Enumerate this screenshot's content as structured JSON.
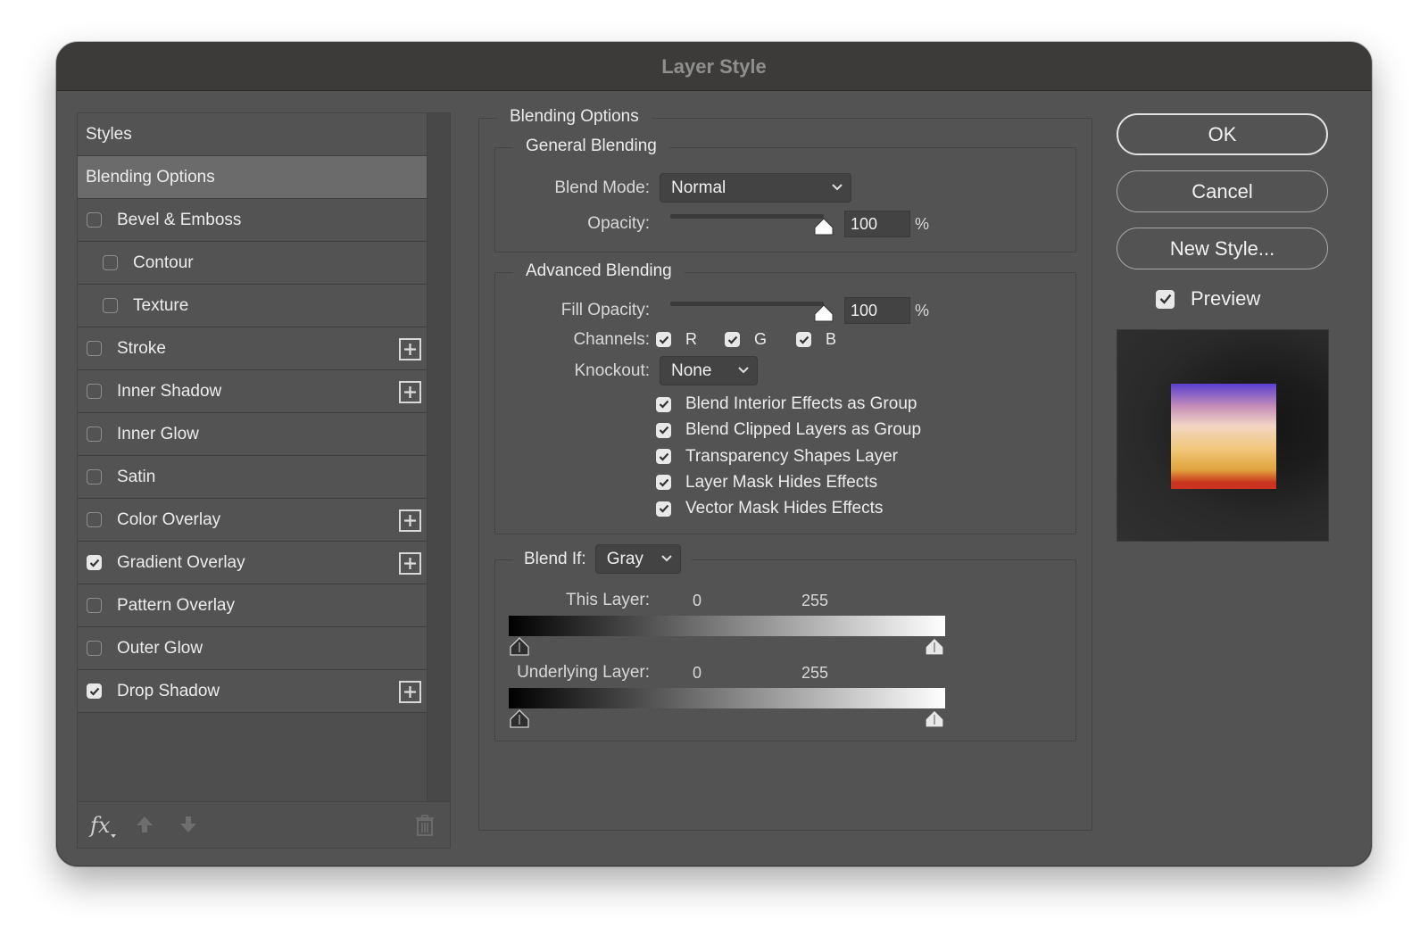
{
  "window": {
    "title": "Layer Style"
  },
  "styles": {
    "header": "Styles",
    "selected": "Blending Options",
    "items": [
      {
        "label": "Bevel & Emboss",
        "checked": false,
        "indent": false,
        "plus": false
      },
      {
        "label": "Contour",
        "checked": false,
        "indent": true,
        "plus": false
      },
      {
        "label": "Texture",
        "checked": false,
        "indent": true,
        "plus": false
      },
      {
        "label": "Stroke",
        "checked": false,
        "indent": false,
        "plus": true
      },
      {
        "label": "Inner Shadow",
        "checked": false,
        "indent": false,
        "plus": true
      },
      {
        "label": "Inner Glow",
        "checked": false,
        "indent": false,
        "plus": false
      },
      {
        "label": "Satin",
        "checked": false,
        "indent": false,
        "plus": false
      },
      {
        "label": "Color Overlay",
        "checked": false,
        "indent": false,
        "plus": true
      },
      {
        "label": "Gradient Overlay",
        "checked": true,
        "indent": false,
        "plus": true
      },
      {
        "label": "Pattern Overlay",
        "checked": false,
        "indent": false,
        "plus": false
      },
      {
        "label": "Outer Glow",
        "checked": false,
        "indent": false,
        "plus": false
      },
      {
        "label": "Drop Shadow",
        "checked": true,
        "indent": false,
        "plus": true
      }
    ],
    "footer": {
      "fx_label": "fx"
    }
  },
  "blending": {
    "title": "Blending Options",
    "general": {
      "title": "General Blending",
      "blend_mode_label": "Blend Mode:",
      "blend_mode": "Normal",
      "opacity_label": "Opacity:",
      "opacity": "100",
      "opacity_unit": "%",
      "opacity_fraction": 1.0
    },
    "advanced": {
      "title": "Advanced Blending",
      "fill_opacity_label": "Fill Opacity:",
      "fill_opacity": "100",
      "fill_opacity_unit": "%",
      "fill_opacity_fraction": 1.0,
      "channels_label": "Channels:",
      "channels": [
        {
          "label": "R",
          "checked": true
        },
        {
          "label": "G",
          "checked": true
        },
        {
          "label": "B",
          "checked": true
        }
      ],
      "knockout_label": "Knockout:",
      "knockout": "None",
      "options": [
        {
          "label": "Blend Interior Effects as Group",
          "checked": true
        },
        {
          "label": "Blend Clipped Layers as Group",
          "checked": true
        },
        {
          "label": "Transparency Shapes Layer",
          "checked": true
        },
        {
          "label": "Layer Mask Hides Effects",
          "checked": true
        },
        {
          "label": "Vector Mask Hides Effects",
          "checked": true
        }
      ]
    },
    "blend_if": {
      "label": "Blend If:",
      "value": "Gray",
      "this_layer": {
        "label": "This Layer:",
        "low": "0",
        "high": "255"
      },
      "underlying_layer": {
        "label": "Underlying Layer:",
        "low": "0",
        "high": "255"
      }
    }
  },
  "actions": {
    "ok": "OK",
    "cancel": "Cancel",
    "new_style": "New Style...",
    "preview_label": "Preview",
    "preview_checked": true
  },
  "colors": {
    "window_bg": "#535353",
    "titlebar_bg": "#3c3b3a",
    "selected_row": "#6b6b6b",
    "preview_gradient": [
      "#5a3fd0",
      "#c68fb8",
      "#f2d6c4",
      "#f0c77a",
      "#e0a23d",
      "#c9331f"
    ]
  }
}
